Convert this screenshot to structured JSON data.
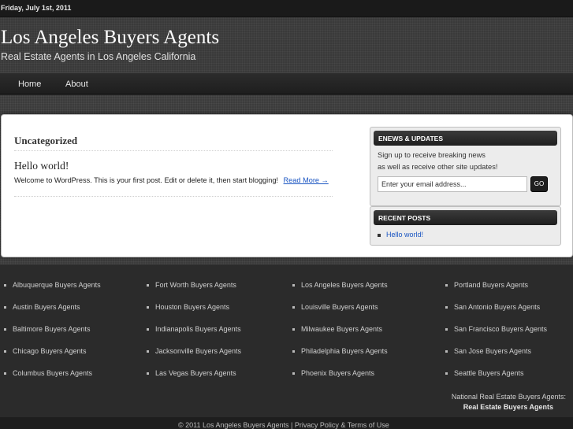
{
  "topbar": {
    "date": "Friday, July 1st, 2011"
  },
  "header": {
    "title": "Los Angeles Buyers Agents",
    "description": "Real Estate Agents in Los Angeles California"
  },
  "nav": {
    "items": [
      "Home",
      "About"
    ]
  },
  "content": {
    "category_title": "Uncategorized",
    "post": {
      "title": "Hello world!",
      "excerpt": "Welcome to WordPress. This is your first post. Edit or delete it, then start blogging!",
      "read_more": "Read More →"
    }
  },
  "sidebar": {
    "enews": {
      "title": "ENEWS & UPDATES",
      "text_line1": "Sign up to receive breaking news",
      "text_line2": "as well as receive other site updates!",
      "email_value": "Enter your email address...",
      "button": "GO"
    },
    "recent_posts": {
      "title": "RECENT POSTS",
      "items": [
        "Hello world!"
      ]
    }
  },
  "footer": {
    "col1": [
      "Albuquerque Buyers Agents",
      "Austin Buyers Agents",
      "Baltimore Buyers Agents",
      "Chicago Buyers Agents",
      "Columbus Buyers Agents"
    ],
    "col2": [
      "Fort Worth Buyers Agents",
      "Houston Buyers Agents",
      "Indianapolis Buyers Agents",
      "Jacksonville Buyers Agents",
      "Las Vegas Buyers Agents"
    ],
    "col3": [
      "Los Angeles Buyers Agents",
      "Louisville Buyers Agents",
      "Milwaukee Buyers Agents",
      "Philadelphia Buyers Agents",
      "Phoenix Buyers Agents"
    ],
    "col4": [
      "Portland Buyers Agents",
      "San Antonio Buyers Agents",
      "San Francisco Buyers Agents",
      "San Jose Buyers Agents",
      "Seattle Buyers Agents"
    ],
    "right_line1": "National Real Estate Buyers Agents:",
    "right_line2": "Real Estate Buyers Agents",
    "copyright": "© 2011 Los Angeles Buyers Agents | Privacy Policy & Terms of Use"
  }
}
